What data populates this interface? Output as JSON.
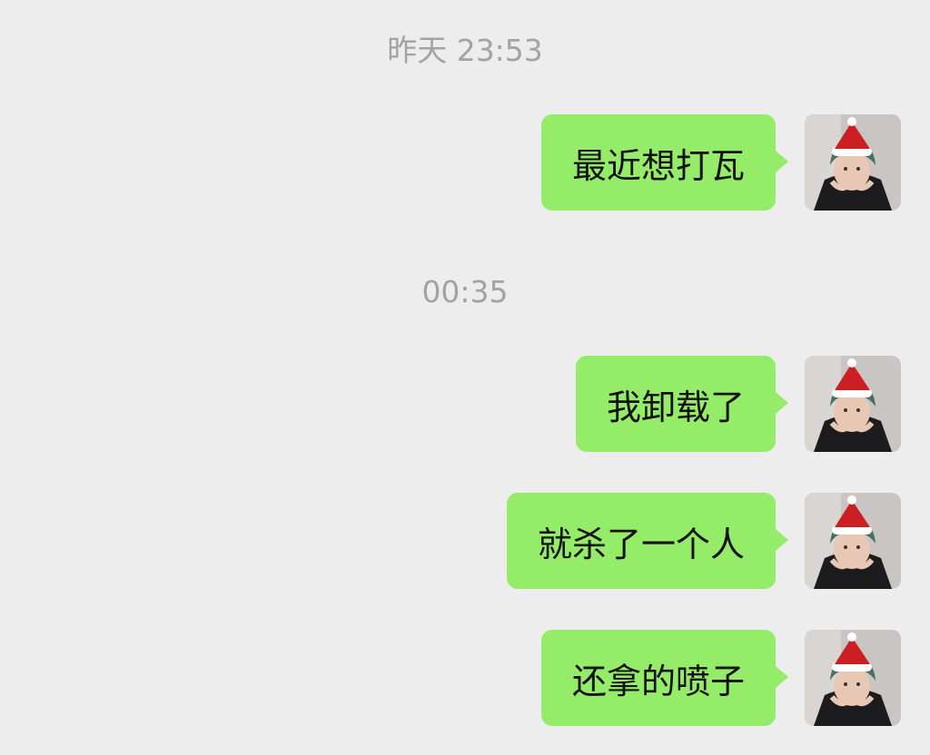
{
  "timestamps": {
    "first": "昨天 23:53",
    "second": "00:35"
  },
  "messages": [
    {
      "text": "最近想打瓦",
      "sender": "self"
    },
    {
      "text": "我卸载了",
      "sender": "self"
    },
    {
      "text": "就杀了一个人",
      "sender": "self"
    },
    {
      "text": "还拿的喷子",
      "sender": "self"
    }
  ],
  "colors": {
    "background": "#ededed",
    "bubble": "#95ec69",
    "timestamp": "#a3a3a3"
  },
  "icons": {
    "avatar": "avatar-santa-hat-icon"
  }
}
